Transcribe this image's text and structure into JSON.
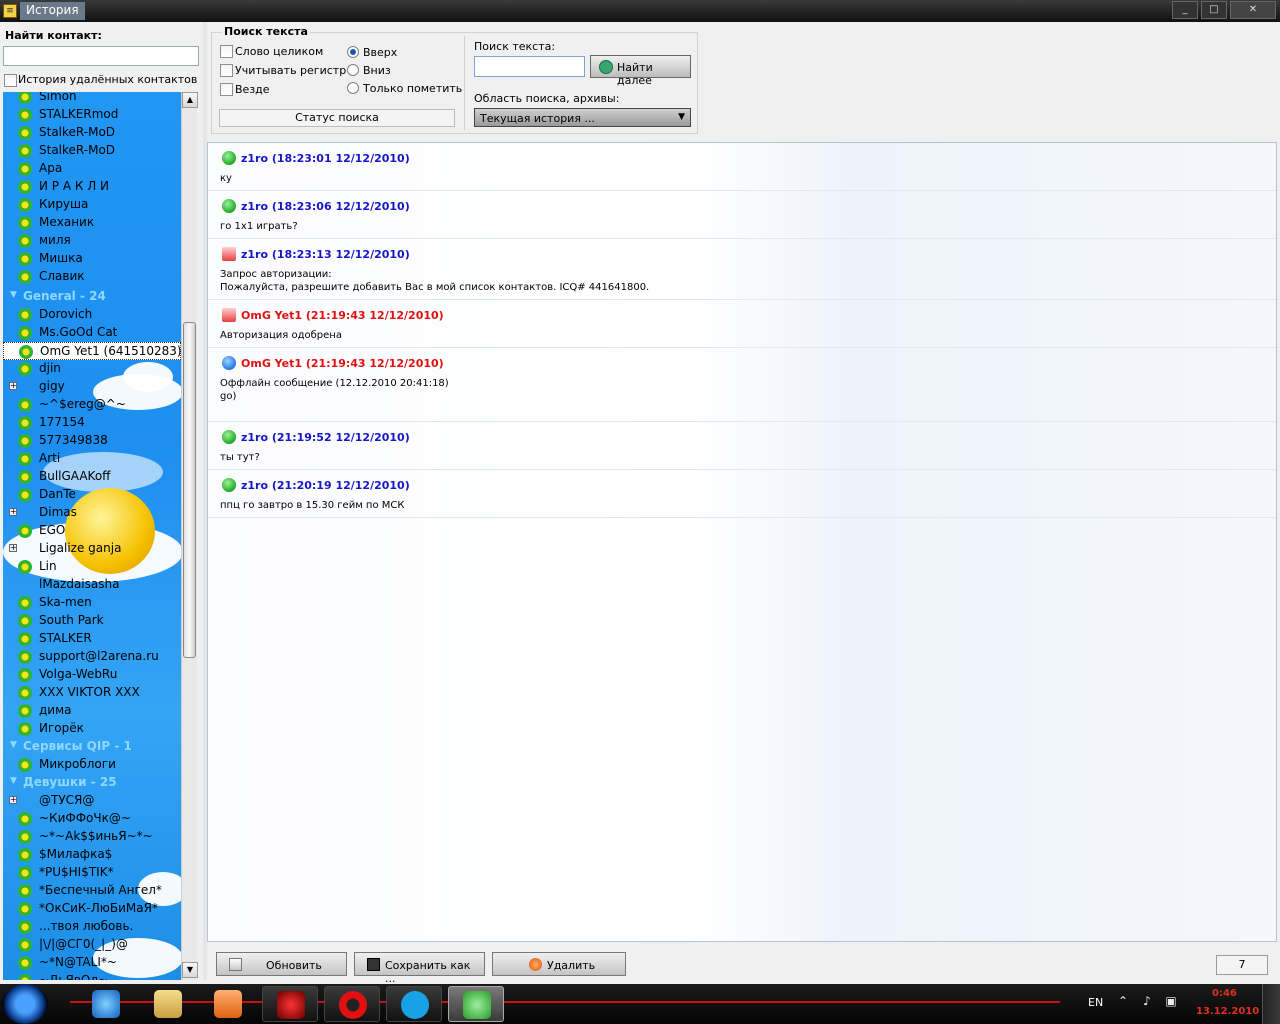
{
  "window": {
    "title": "История"
  },
  "left": {
    "find_label": "Найти контакт:",
    "find_value": "",
    "deleted_history_label": "История удалённых контактов",
    "contacts_top": [
      {
        "name": "Simon"
      },
      {
        "name": "STALKERmod"
      },
      {
        "name": "StalkeR-MoD"
      },
      {
        "name": "StalkeR-MoD"
      },
      {
        "name": "Apa"
      },
      {
        "name": "И Р А К Л И"
      },
      {
        "name": "Кируша"
      },
      {
        "name": "Механик"
      },
      {
        "name": "миля"
      },
      {
        "name": "Мишка"
      },
      {
        "name": "Славик"
      }
    ],
    "group_general": "General - 24",
    "contacts_general": [
      {
        "name": "Dorovich"
      },
      {
        "name": "Ms.GoOd Cat"
      },
      {
        "name": "OmG Yet1 (641510283)"
      },
      {
        "name": "djin"
      },
      {
        "name": "gigy"
      },
      {
        "name": "~^$ereg@^~"
      },
      {
        "name": "177154"
      },
      {
        "name": "577349838"
      },
      {
        "name": "Arti"
      },
      {
        "name": "BullGAAKoff"
      },
      {
        "name": "DanTe"
      },
      {
        "name": "Dimas"
      },
      {
        "name": "EGO"
      },
      {
        "name": "Ligalize ganja"
      },
      {
        "name": "Lin"
      },
      {
        "name": "lMazdaisasha"
      },
      {
        "name": "Ska-men"
      },
      {
        "name": "South Park"
      },
      {
        "name": "STALKER"
      },
      {
        "name": "support@l2arena.ru"
      },
      {
        "name": "Volga-WebRu"
      },
      {
        "name": "XXX VIKTOR XXX"
      },
      {
        "name": "дима"
      },
      {
        "name": "Игорёк"
      }
    ],
    "group_services": "Сервисы QIP - 1",
    "contacts_services": [
      {
        "name": "Микроблоги"
      }
    ],
    "group_girls": "Девушки - 25",
    "contacts_girls": [
      {
        "name": "@ТУСЯ@"
      },
      {
        "name": "~КиФФоЧк@~"
      },
      {
        "name": "~*~Ak$$иньЯ~*~"
      },
      {
        "name": "$Милафка$"
      },
      {
        "name": "*PU$HI$TIK*"
      },
      {
        "name": "*Беспечный Ангел*"
      },
      {
        "name": "*ОкСиК-ЛюБиМаЯ*"
      },
      {
        "name": "...твоя любовь."
      },
      {
        "name": "|\\/|@СГ0(_|_)@"
      },
      {
        "name": "~*N@TALI*~"
      },
      {
        "name": "~ДьЯвОл~"
      }
    ]
  },
  "search": {
    "section_title": "Поиск текста",
    "whole_word": "Слово целиком",
    "match_case": "Учитывать регистр",
    "everywhere": "Везде",
    "dir_up": "Вверх",
    "dir_down": "Вниз",
    "mark_only": "Только пометить",
    "status_button": "Статус поиска",
    "text_label": "Поиск текста:",
    "text_value": "",
    "find_next": "Найти далее",
    "area_label": "Область поиска, архивы:",
    "area_value": "Текущая история ..."
  },
  "messages": [
    {
      "header": "z1ro (18:23:01 12/12/2010)",
      "body": "ку",
      "icon": "green-smiley-icon"
    },
    {
      "header": "z1ro (18:23:06 12/12/2010)",
      "body": "го 1х1 играть?",
      "icon": "green-smiley-icon"
    },
    {
      "header": "z1ro (18:23:13 12/12/2010)",
      "body": "Запрос авторизации:\nПожалуйста, разрешите добавить Вас в мой список контактов. ICQ# 441641800.",
      "icon": "authorization-icon"
    },
    {
      "header": "OmG Yet1 (21:19:43 12/12/2010)",
      "body": "Авторизация одобрена",
      "icon": "authorization-icon"
    },
    {
      "header": "OmG Yet1 (21:19:43 12/12/2010)",
      "body": "Оффлайн сообщение (12.12.2010 20:41:18)\ngo)",
      "icon": "blue-smiley-icon"
    },
    {
      "header": "z1ro (21:19:52 12/12/2010)",
      "body": "ты тут?",
      "icon": "green-smiley-icon"
    },
    {
      "header": "z1ro (21:20:19 12/12/2010)",
      "body": "ппц го завтро в 15.30 гейм по МСК",
      "icon": "green-smiley-icon"
    }
  ],
  "bottom": {
    "refresh": "Обновить",
    "save_as": "Сохранить как ...",
    "delete": "Удалить",
    "count": "7"
  },
  "taskbar": {
    "lang": "EN",
    "time": "0:46",
    "date": "13.12.2010"
  },
  "colors": {
    "sender_self": "#1616c8",
    "sender_other": "#e01010",
    "list_bg": "#2196f3"
  }
}
